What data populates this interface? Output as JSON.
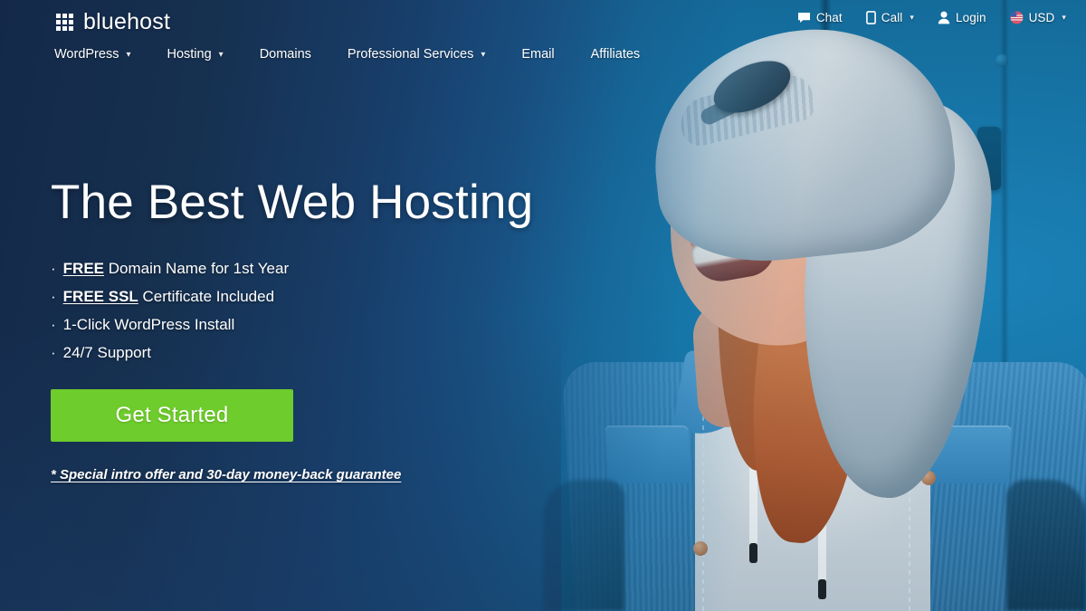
{
  "brand": {
    "name": "bluehost",
    "logo_icon": "grid-squares-icon"
  },
  "utility_nav": [
    {
      "label": "Chat",
      "icon": "chat-bubble-icon",
      "caret": ""
    },
    {
      "label": "Call",
      "icon": "mobile-phone-icon",
      "caret": "▾"
    },
    {
      "label": "Login",
      "icon": "user-person-icon",
      "caret": ""
    },
    {
      "label": "USD",
      "icon": "currency-flag-icon",
      "caret": "▾"
    }
  ],
  "main_nav": [
    {
      "label": "WordPress",
      "caret": "▾"
    },
    {
      "label": "Hosting",
      "caret": "▾"
    },
    {
      "label": "Domains",
      "caret": ""
    },
    {
      "label": "Professional Services",
      "caret": "▾"
    },
    {
      "label": "Email",
      "caret": ""
    },
    {
      "label": "Affiliates",
      "caret": ""
    }
  ],
  "hero": {
    "headline": "The Best Web Hosting",
    "bullet_marker": "·",
    "bullets": [
      {
        "bold": "FREE",
        "rest": " Domain Name for 1st Year"
      },
      {
        "bold": "FREE SSL",
        "rest": " Certificate Included"
      },
      {
        "bold": "",
        "rest": "1-Click WordPress Install"
      },
      {
        "bold": "",
        "rest": "24/7 Support"
      }
    ],
    "cta_label": "Get Started",
    "footnote": "* Special intro offer and 30-day money-back guarantee"
  },
  "colors": {
    "cta_green": "#6ecc2c",
    "bg_navy_dark": "#14294a",
    "bg_blue_mid": "#1c5086",
    "bg_teal_bright": "#1378b0",
    "text_white": "#ffffff"
  },
  "photo": {
    "alt": "Smiling young woman with glasses, gray beanie hood and denim jacket against a blue wall"
  }
}
